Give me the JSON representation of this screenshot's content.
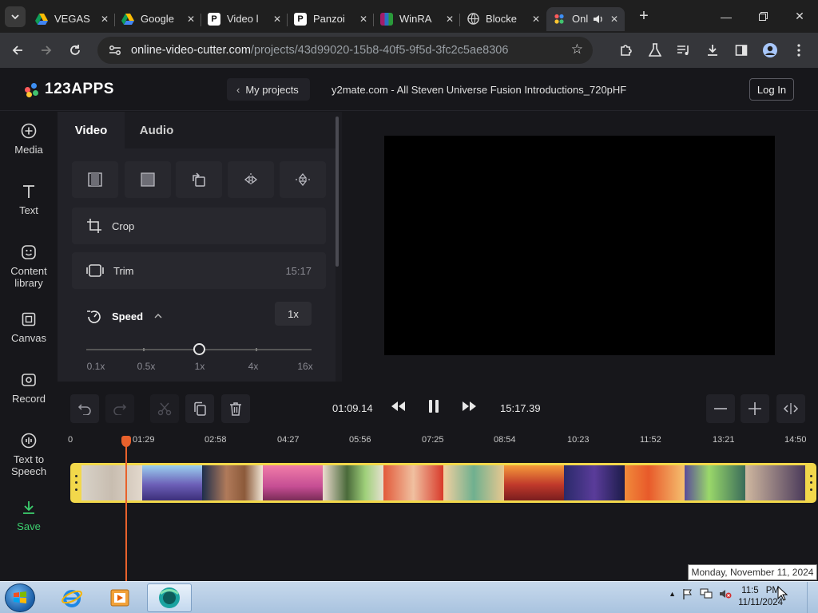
{
  "browser": {
    "tabs": [
      {
        "title": "VEGAS",
        "favicon": "google-drive-icon"
      },
      {
        "title": "Google",
        "favicon": "google-drive-icon"
      },
      {
        "title": "Video l",
        "favicon": "p-icon"
      },
      {
        "title": "Panzoi",
        "favicon": "p-icon"
      },
      {
        "title": "WinRA",
        "favicon": "winrar-icon"
      },
      {
        "title": "Blocke",
        "favicon": "globe-icon"
      },
      {
        "title": "Onl",
        "favicon": "123apps-icon"
      }
    ],
    "url_host": "online-video-cutter.com",
    "url_path": "/projects/43d99020-15b8-40f5-9f5d-3fc2c5ae8306"
  },
  "app": {
    "logo": "123APPS",
    "my_projects": "My projects",
    "file_title": "y2mate.com - All Steven Universe Fusion Introductions_720pHF",
    "login": "Log In"
  },
  "rail": [
    {
      "label": "Media"
    },
    {
      "label": "Text"
    },
    {
      "label": "Content library"
    },
    {
      "label": "Canvas"
    },
    {
      "label": "Record"
    },
    {
      "label": "Text to Speech"
    },
    {
      "label": "Save"
    }
  ],
  "panel": {
    "tabs": [
      "Video",
      "Audio"
    ],
    "crop": "Crop",
    "trim": "Trim",
    "trim_value": "15:17",
    "speed": "Speed",
    "speed_value": "1x",
    "speed_marks": [
      "0.1x",
      "0.5x",
      "1x",
      "4x",
      "16x"
    ],
    "speed_level": 1
  },
  "transport": {
    "current_time": "01:09.14",
    "total_time": "15:17.39"
  },
  "timeline": {
    "ruler": [
      "0",
      "01:29",
      "02:58",
      "04:27",
      "05:56",
      "07:25",
      "08:54",
      "10:23",
      "11:52",
      "13:21",
      "14:50"
    ],
    "playhead_time": "01:09.14",
    "strip_color": "#f2d84b",
    "playhead_color": "#e8612c"
  },
  "taskbar": {
    "time": "11:5",
    "time_suffix": "PM",
    "date": "11/11/2024",
    "tooltip": "Monday, November 11, 2024"
  }
}
